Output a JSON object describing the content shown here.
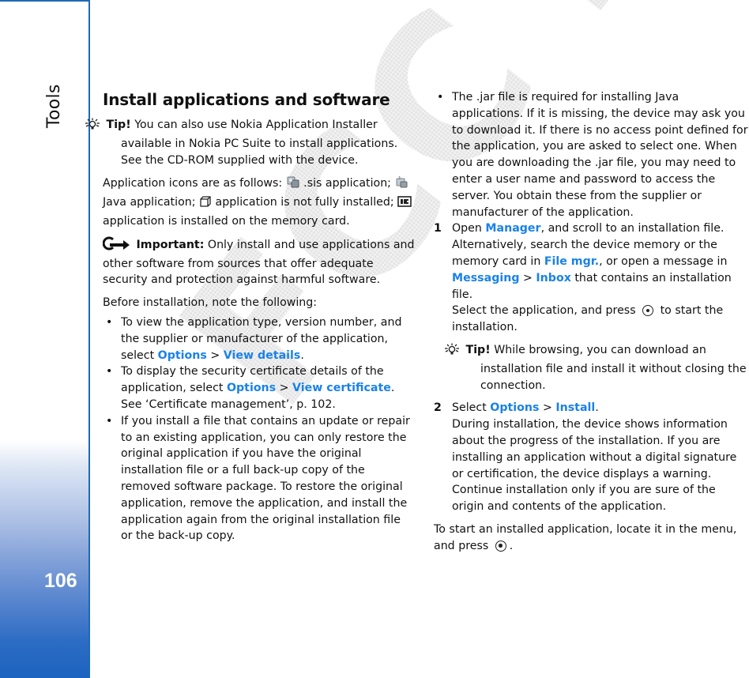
{
  "sidebar": {
    "section_title": "Tools",
    "page_number": "106"
  },
  "watermark": "FCC Draft",
  "colors": {
    "accent_blue": "#1a82e8",
    "sidebar_border": "#1f68b8",
    "sidebar_gradient_bottom": "#1b63bf"
  },
  "left": {
    "title": "Install applications and software",
    "tip": {
      "label": "Tip!",
      "text": " You can also use Nokia Application Installer available in Nokia PC Suite to install applications. See the CD-ROM supplied with the device."
    },
    "icons_para": {
      "intro": "Application icons are as follows: ",
      "sis": " .sis application; ",
      "java": " Java application; ",
      "partial": " application is not fully installed; ",
      "memcard": " application is installed on the memory card."
    },
    "important": {
      "label": "Important:",
      "text": " Only install and use applications and other software from sources that offer adequate security and protection against harmful software."
    },
    "before": "Before installation, note the following:",
    "bullets": [
      {
        "text": "To view the application type, version number, and the supplier or manufacturer of the application, select ",
        "link1": "Options",
        "sep": " > ",
        "link2": "View details",
        "tail": "."
      },
      {
        "text": "To display the security certificate details of the application, select ",
        "link1": "Options",
        "sep": " > ",
        "link2": "View certificate",
        "tail": ". See ‘Certificate management’, p. 102."
      },
      {
        "text": "If you install a file that contains an update or repair to an existing application, you can only restore the original application if you have the original installation file or a full back-up copy of the removed software package. To restore the original application, remove the application, and install the application again from the original installation file or the back-up copy."
      }
    ]
  },
  "right": {
    "bullet": "The .jar file is required for installing Java applications. If it is missing, the device may ask you to download it. If there is no access point defined for the application, you are asked to select one. When you are downloading the .jar file, you may need to enter a user name and password to access the server. You obtain these from the supplier or manufacturer of the application.",
    "steps": [
      {
        "num": "1",
        "t1": "Open ",
        "l1": "Manager",
        "t2": ", and scroll to an installation file. Alternatively, search the device memory or the memory card in ",
        "l2": "File mgr.",
        "t3": ", or open a message in ",
        "l3": "Messaging",
        "t4": " > ",
        "l4": "Inbox",
        "t5": " that contains an installation file.",
        "t6": "Select the application, and press ",
        "t7": " to start the installation.",
        "tip_label": "Tip!",
        "tip_text": " While browsing, you can download an installation file and install it without closing the connection."
      },
      {
        "num": "2",
        "t1": "Select ",
        "l1": "Options",
        "sep": " > ",
        "l2": "Install",
        "t2": ".",
        "t3": "During installation, the device shows information about the progress of the installation. If you are installing an application without a digital signature or certification, the device displays a warning. Continue installation only if you are sure of the origin and contents of the application."
      }
    ],
    "closing": {
      "text": "To start an installed application, locate it in the menu, and press ",
      "tail": "."
    }
  }
}
